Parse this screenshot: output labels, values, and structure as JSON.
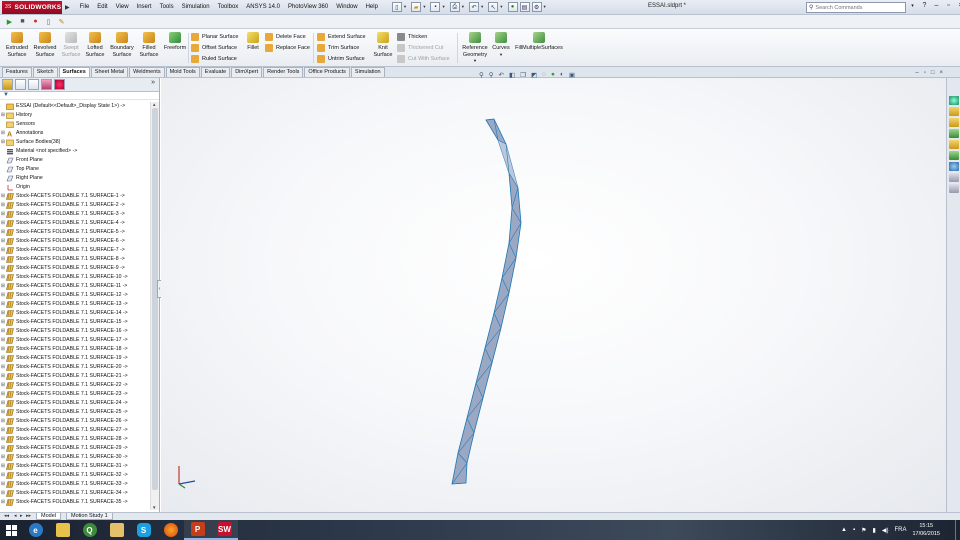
{
  "app": {
    "logo_text": "SOLIDWORKS",
    "logo_prefix": "3S",
    "document_title": "ESSAI.sldprt *"
  },
  "menu": [
    "File",
    "Edit",
    "View",
    "Insert",
    "Tools",
    "Simulation",
    "Toolbox",
    "ANSYS 14.0",
    "PhotoView 360",
    "Window",
    "Help"
  ],
  "search": {
    "placeholder": "Search Commands"
  },
  "ribbon": {
    "extruded_surface": "Extruded Surface",
    "revolved_surface": "Revolved Surface",
    "swept_surface": "Swept Surface",
    "lofted_surface": "Lofted Surface",
    "boundary_surface": "Boundary Surface",
    "filled_surface": "Filled Surface",
    "freeform": "Freeform",
    "planar_surface": "Planar Surface",
    "offset_surface": "Offset Surface",
    "ruled_surface": "Ruled Surface",
    "fillet": "Fillet",
    "delete_face": "Delete Face",
    "replace_face": "Replace Face",
    "extend_surface": "Extend Surface",
    "trim_surface": "Trim Surface",
    "untrim_surface": "Untrim Surface",
    "knit_surface": "Knit Surface",
    "thicken": "Thicken",
    "thickened_cut": "Thickened Cut",
    "cut_with_surface": "Cut With Surface",
    "reference_geometry": "Reference Geometry",
    "curves": "Curves",
    "fill_multiple_surfaces": "FillMultipleSurfaces"
  },
  "tabs": [
    "Features",
    "Sketch",
    "Surfaces",
    "Sheet Metal",
    "Weldments",
    "Mold Tools",
    "Evaluate",
    "DimXpert",
    "Render Tools",
    "Office Products",
    "Simulation"
  ],
  "active_tab": "Surfaces",
  "tree": {
    "root": "ESSAI  (Default<<Default>_Display State 1>) ->",
    "history": "History",
    "sensors": "Sensors",
    "annotations": "Annotations",
    "surface_bodies": "Surface Bodies(38)",
    "material": "Material <not specified> ->",
    "front_plane": "Front Plane",
    "top_plane": "Top Plane",
    "right_plane": "Right Plane",
    "origin": "Origin",
    "features": [
      "Stock-FACETS FOLDABLE 7.1 SURFACE-1 ->",
      "Stock-FACETS FOLDABLE 7.1 SURFACE-2 ->",
      "Stock-FACETS FOLDABLE 7.1 SURFACE-3 ->",
      "Stock-FACETS FOLDABLE 7.1 SURFACE-4 ->",
      "Stock-FACETS FOLDABLE 7.1 SURFACE-5 ->",
      "Stock-FACETS FOLDABLE 7.1 SURFACE-6 ->",
      "Stock-FACETS FOLDABLE 7.1 SURFACE-7 ->",
      "Stock-FACETS FOLDABLE 7.1 SURFACE-8 ->",
      "Stock-FACETS FOLDABLE 7.1 SURFACE-9 ->",
      "Stock-FACETS FOLDABLE 7.1 SURFACE-10 ->",
      "Stock-FACETS FOLDABLE 7.1 SURFACE-11 ->",
      "Stock-FACETS FOLDABLE 7.1 SURFACE-12 ->",
      "Stock-FACETS FOLDABLE 7.1 SURFACE-13 ->",
      "Stock-FACETS FOLDABLE 7.1 SURFACE-14 ->",
      "Stock-FACETS FOLDABLE 7.1 SURFACE-15 ->",
      "Stock-FACETS FOLDABLE 7.1 SURFACE-16 ->",
      "Stock-FACETS FOLDABLE 7.1 SURFACE-17 ->",
      "Stock-FACETS FOLDABLE 7.1 SURFACE-18 ->",
      "Stock-FACETS FOLDABLE 7.1 SURFACE-19 ->",
      "Stock-FACETS FOLDABLE 7.1 SURFACE-20 ->",
      "Stock-FACETS FOLDABLE 7.1 SURFACE-21 ->",
      "Stock-FACETS FOLDABLE 7.1 SURFACE-22 ->",
      "Stock-FACETS FOLDABLE 7.1 SURFACE-23 ->",
      "Stock-FACETS FOLDABLE 7.1 SURFACE-24 ->",
      "Stock-FACETS FOLDABLE 7.1 SURFACE-25 ->",
      "Stock-FACETS FOLDABLE 7.1 SURFACE-26 ->",
      "Stock-FACETS FOLDABLE 7.1 SURFACE-27 ->",
      "Stock-FACETS FOLDABLE 7.1 SURFACE-28 ->",
      "Stock-FACETS FOLDABLE 7.1 SURFACE-29 ->",
      "Stock-FACETS FOLDABLE 7.1 SURFACE-30 ->",
      "Stock-FACETS FOLDABLE 7.1 SURFACE-31 ->",
      "Stock-FACETS FOLDABLE 7.1 SURFACE-32 ->",
      "Stock-FACETS FOLDABLE 7.1 SURFACE-33 ->",
      "Stock-FACETS FOLDABLE 7.1 SURFACE-34 ->",
      "Stock-FACETS FOLDABLE 7.1 SURFACE-35 ->"
    ]
  },
  "bottom_tabs": {
    "model": "Model",
    "motion_study": "Motion Study 1"
  },
  "taskbar": {
    "language": "FRA",
    "time": "15:15",
    "date": "17/06/2015",
    "apps": [
      "ie-icon",
      "explorer-icon",
      "app-green-icon",
      "folder-icon",
      "skype-icon",
      "firefox-icon",
      "powerpoint-icon",
      "solidworks-icon"
    ]
  },
  "colors": {
    "solidworks_red": "#c8102e",
    "part_face": "#9aa8c4",
    "part_edge": "#1f78b4"
  }
}
